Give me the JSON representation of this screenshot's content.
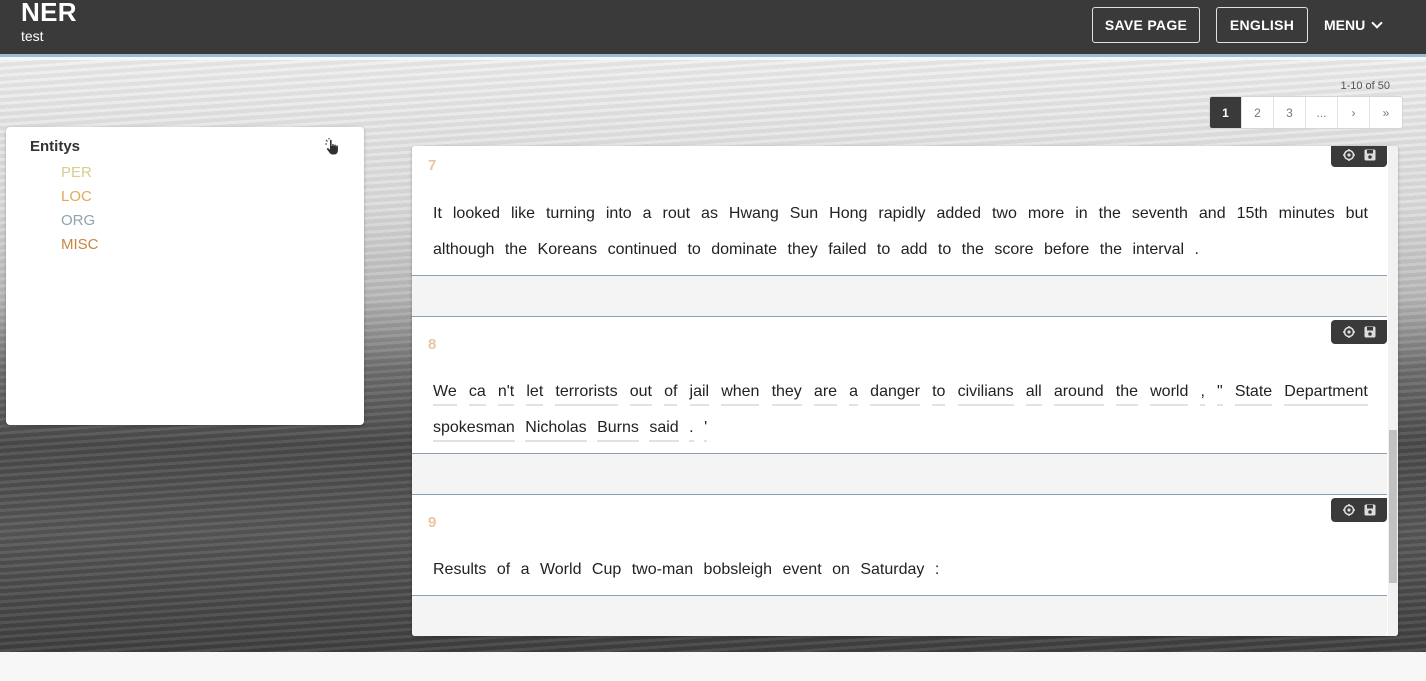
{
  "header": {
    "title": "NER",
    "subtitle": "test",
    "save_label": "SAVE PAGE",
    "language_label": "ENGLISH",
    "menu_label": "MENU"
  },
  "pagination": {
    "range_text": "1-10 of 50",
    "pages": [
      "1",
      "2",
      "3",
      "...",
      "›",
      "»"
    ],
    "active_page": "1"
  },
  "entities": {
    "title": "Entitys",
    "items": [
      {
        "label": "PER",
        "color": "#d6cf8e"
      },
      {
        "label": "LOC",
        "color": "#e3a85a"
      },
      {
        "label": "ORG",
        "color": "#8fa3b0"
      },
      {
        "label": "MISC",
        "color": "#c9853f"
      }
    ]
  },
  "sentences": [
    {
      "number": "7",
      "tokens": [
        "It",
        "looked",
        "like",
        "turning",
        "into",
        "a",
        "rout",
        "as",
        "Hwang",
        "Sun",
        "Hong",
        "rapidly",
        "added",
        "two",
        "more",
        "in",
        "the",
        "seventh",
        "and",
        "15th",
        "minutes",
        "but",
        "although",
        "the",
        "Koreans",
        "continued",
        "to",
        "dominate",
        "they",
        "failed",
        "to",
        "add",
        "to",
        "the",
        "score",
        "before",
        "the",
        "interval",
        "."
      ],
      "underlined": false
    },
    {
      "number": "8",
      "tokens": [
        "We",
        "ca",
        "n't",
        "let",
        "terrorists",
        "out",
        "of",
        "jail",
        "when",
        "they",
        "are",
        "a",
        "danger",
        "to",
        "civilians",
        "all",
        "around",
        "the",
        "world",
        ",",
        "\"",
        "State",
        "Department",
        "spokesman",
        "Nicholas",
        "Burns",
        "said",
        ".",
        "'"
      ],
      "underlined": true
    },
    {
      "number": "9",
      "tokens": [
        "Results",
        "of",
        "a",
        "World",
        "Cup",
        "two-man",
        "bobsleigh",
        "event",
        "on",
        "Saturday",
        ":"
      ],
      "underlined": false
    }
  ],
  "icons": {
    "pointer": "hand-pointer-icon",
    "tool_a": "tag-settings-icon",
    "tool_b": "save-icon",
    "menu_chevron": "chevron-down-icon"
  }
}
